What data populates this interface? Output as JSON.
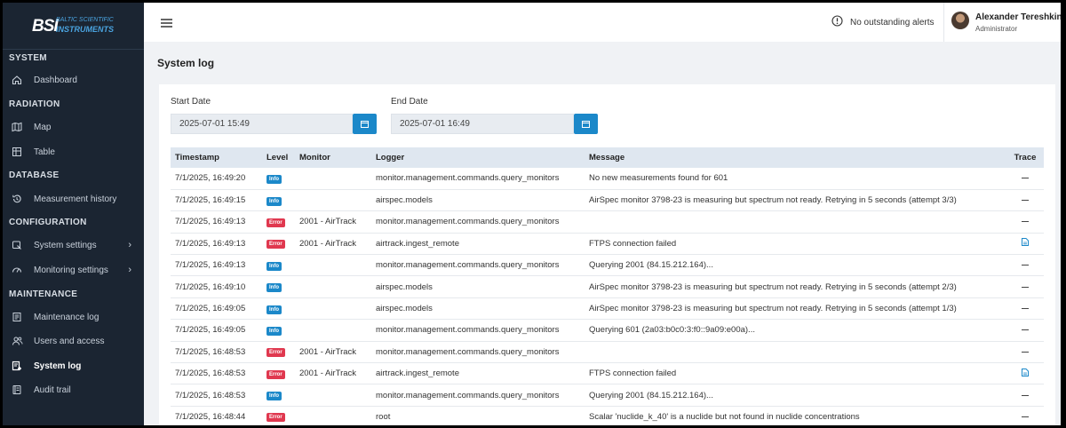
{
  "brand": {
    "line1": "BALTIC SCIENTIFIC",
    "line2": "INSTRUMENTS",
    "mark": "BSI"
  },
  "sidebar": {
    "sections": [
      {
        "label": "SYSTEM",
        "items": [
          {
            "label": "Dashboard",
            "icon": "home-icon"
          }
        ]
      },
      {
        "label": "RADIATION",
        "items": [
          {
            "label": "Map",
            "icon": "map-icon"
          },
          {
            "label": "Table",
            "icon": "table-icon"
          }
        ]
      },
      {
        "label": "DATABASE",
        "items": [
          {
            "label": "Measurement history",
            "icon": "history-icon"
          }
        ]
      },
      {
        "label": "CONFIGURATION",
        "items": [
          {
            "label": "System settings",
            "icon": "settings-icon",
            "chevron": true
          },
          {
            "label": "Monitoring settings",
            "icon": "gauge-icon",
            "chevron": true
          }
        ]
      },
      {
        "label": "MAINTENANCE",
        "items": [
          {
            "label": "Maintenance log",
            "icon": "log-icon"
          },
          {
            "label": "Users and access",
            "icon": "users-icon"
          },
          {
            "label": "System log",
            "icon": "system-log-icon",
            "active": true
          },
          {
            "label": "Audit trail",
            "icon": "audit-icon"
          }
        ]
      }
    ]
  },
  "topbar": {
    "alerts": "No outstanding alerts",
    "user_name": "Alexander Tereshkin",
    "user_role": "Administrator"
  },
  "page": {
    "title": "System log"
  },
  "filters": {
    "start_label": "Start Date",
    "start_value": "2025-07-01 15:49",
    "end_label": "End Date",
    "end_value": "2025-07-01 16:49"
  },
  "table": {
    "headers": {
      "timestamp": "Timestamp",
      "level": "Level",
      "monitor": "Monitor",
      "logger": "Logger",
      "message": "Message",
      "trace": "Trace"
    },
    "rows": [
      {
        "timestamp": "7/1/2025, 16:49:20",
        "level": "Info",
        "monitor": "",
        "logger": "monitor.management.commands.query_monitors",
        "message": "No new measurements found for 601",
        "trace": "dash"
      },
      {
        "timestamp": "7/1/2025, 16:49:15",
        "level": "Info",
        "monitor": "",
        "logger": "airspec.models",
        "message": "AirSpec monitor 3798-23 is measuring but spectrum not ready. Retrying in 5 seconds (attempt 3/3)",
        "trace": "dash"
      },
      {
        "timestamp": "7/1/2025, 16:49:13",
        "level": "Error",
        "monitor": "2001 - AirTrack",
        "logger": "monitor.management.commands.query_monitors",
        "message": "",
        "trace": "dash"
      },
      {
        "timestamp": "7/1/2025, 16:49:13",
        "level": "Error",
        "monitor": "2001 - AirTrack",
        "logger": "airtrack.ingest_remote",
        "message": "FTPS connection failed",
        "trace": "doc"
      },
      {
        "timestamp": "7/1/2025, 16:49:13",
        "level": "Info",
        "monitor": "",
        "logger": "monitor.management.commands.query_monitors",
        "message": "Querying 2001 (84.15.212.164)...",
        "trace": "dash"
      },
      {
        "timestamp": "7/1/2025, 16:49:10",
        "level": "Info",
        "monitor": "",
        "logger": "airspec.models",
        "message": "AirSpec monitor 3798-23 is measuring but spectrum not ready. Retrying in 5 seconds (attempt 2/3)",
        "trace": "dash"
      },
      {
        "timestamp": "7/1/2025, 16:49:05",
        "level": "Info",
        "monitor": "",
        "logger": "airspec.models",
        "message": "AirSpec monitor 3798-23 is measuring but spectrum not ready. Retrying in 5 seconds (attempt 1/3)",
        "trace": "dash"
      },
      {
        "timestamp": "7/1/2025, 16:49:05",
        "level": "Info",
        "monitor": "",
        "logger": "monitor.management.commands.query_monitors",
        "message": "Querying 601 (2a03:b0c0:3:f0::9a09:e00a)...",
        "trace": "dash"
      },
      {
        "timestamp": "7/1/2025, 16:48:53",
        "level": "Error",
        "monitor": "2001 - AirTrack",
        "logger": "monitor.management.commands.query_monitors",
        "message": "",
        "trace": "dash"
      },
      {
        "timestamp": "7/1/2025, 16:48:53",
        "level": "Error",
        "monitor": "2001 - AirTrack",
        "logger": "airtrack.ingest_remote",
        "message": "FTPS connection failed",
        "trace": "doc"
      },
      {
        "timestamp": "7/1/2025, 16:48:53",
        "level": "Info",
        "monitor": "",
        "logger": "monitor.management.commands.query_monitors",
        "message": "Querying 2001 (84.15.212.164)...",
        "trace": "dash"
      },
      {
        "timestamp": "7/1/2025, 16:48:44",
        "level": "Error",
        "monitor": "",
        "logger": "root",
        "message": "Scalar 'nuclide_k_40' is a nuclide but not found in nuclide concentrations",
        "trace": "dash"
      }
    ]
  },
  "colors": {
    "sidebar": "#1b2532",
    "accent": "#1b88c9",
    "error": "#e0384f",
    "header_row": "#dfe7f0"
  }
}
